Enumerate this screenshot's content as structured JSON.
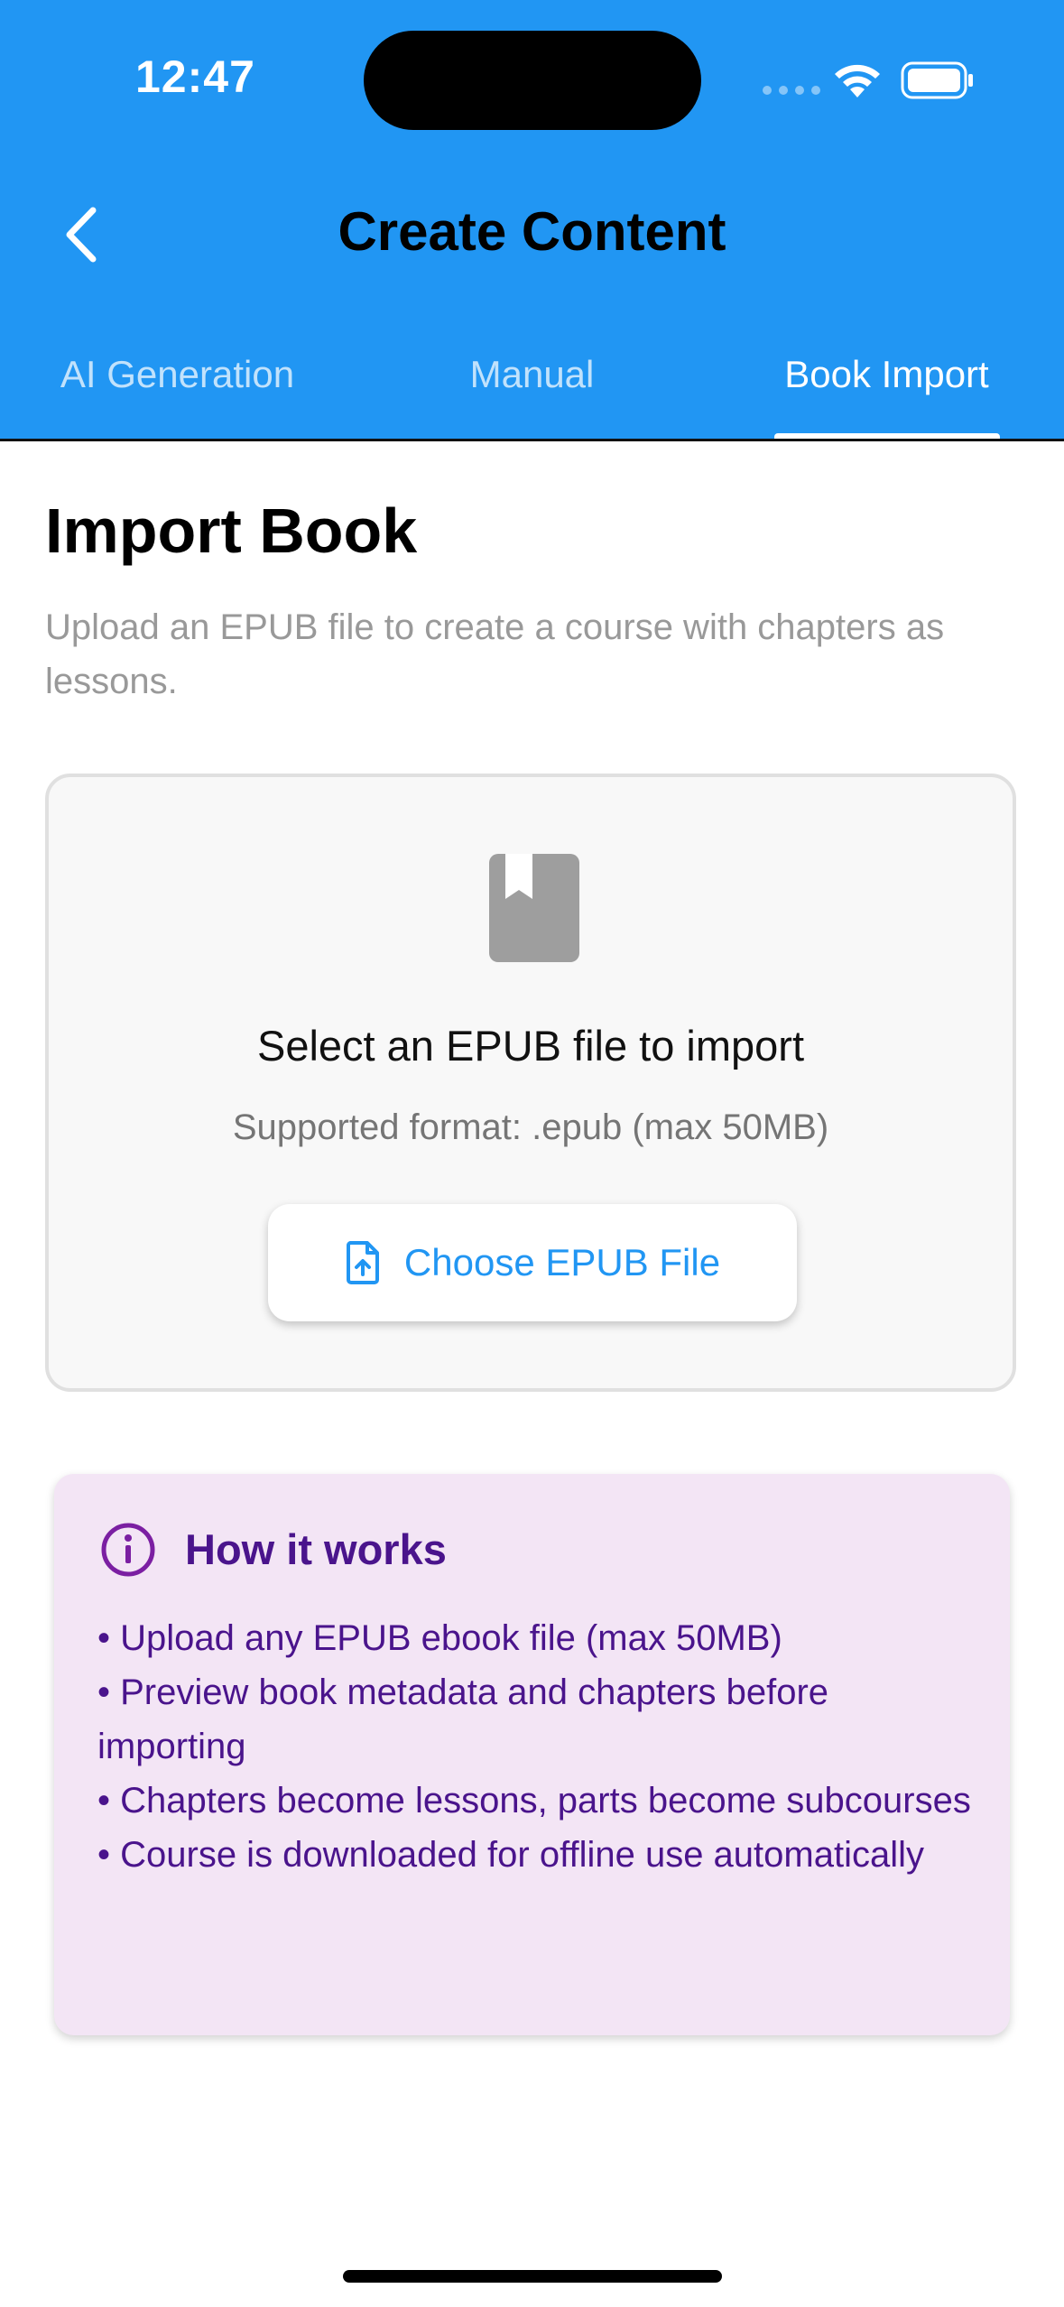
{
  "status_bar": {
    "time": "12:47"
  },
  "header": {
    "title": "Create Content",
    "back_icon": "chevron-left-icon",
    "background_color": "#2196F3"
  },
  "tabs": [
    {
      "label": "AI Generation",
      "active": false
    },
    {
      "label": "Manual",
      "active": false
    },
    {
      "label": "Book Import",
      "active": true
    }
  ],
  "main": {
    "title": "Import Book",
    "description": "Upload an EPUB file to create a course with chapters as lessons."
  },
  "upload_card": {
    "icon": "book-icon",
    "title": "Select an EPUB file to import",
    "subtitle": "Supported format: .epub (max 50MB)",
    "button_label": "Choose EPUB File",
    "button_icon": "file-upload-icon"
  },
  "info_card": {
    "icon": "info-icon",
    "title": "How it works",
    "lines": [
      "• Upload any EPUB ebook file (max 50MB)",
      "• Preview book metadata and chapters before importing",
      "• Chapters become lessons, parts become subcourses",
      "• Course is downloaded for offline use automatically"
    ],
    "background_color": "#F3E5F5",
    "text_color": "#4A148C"
  }
}
